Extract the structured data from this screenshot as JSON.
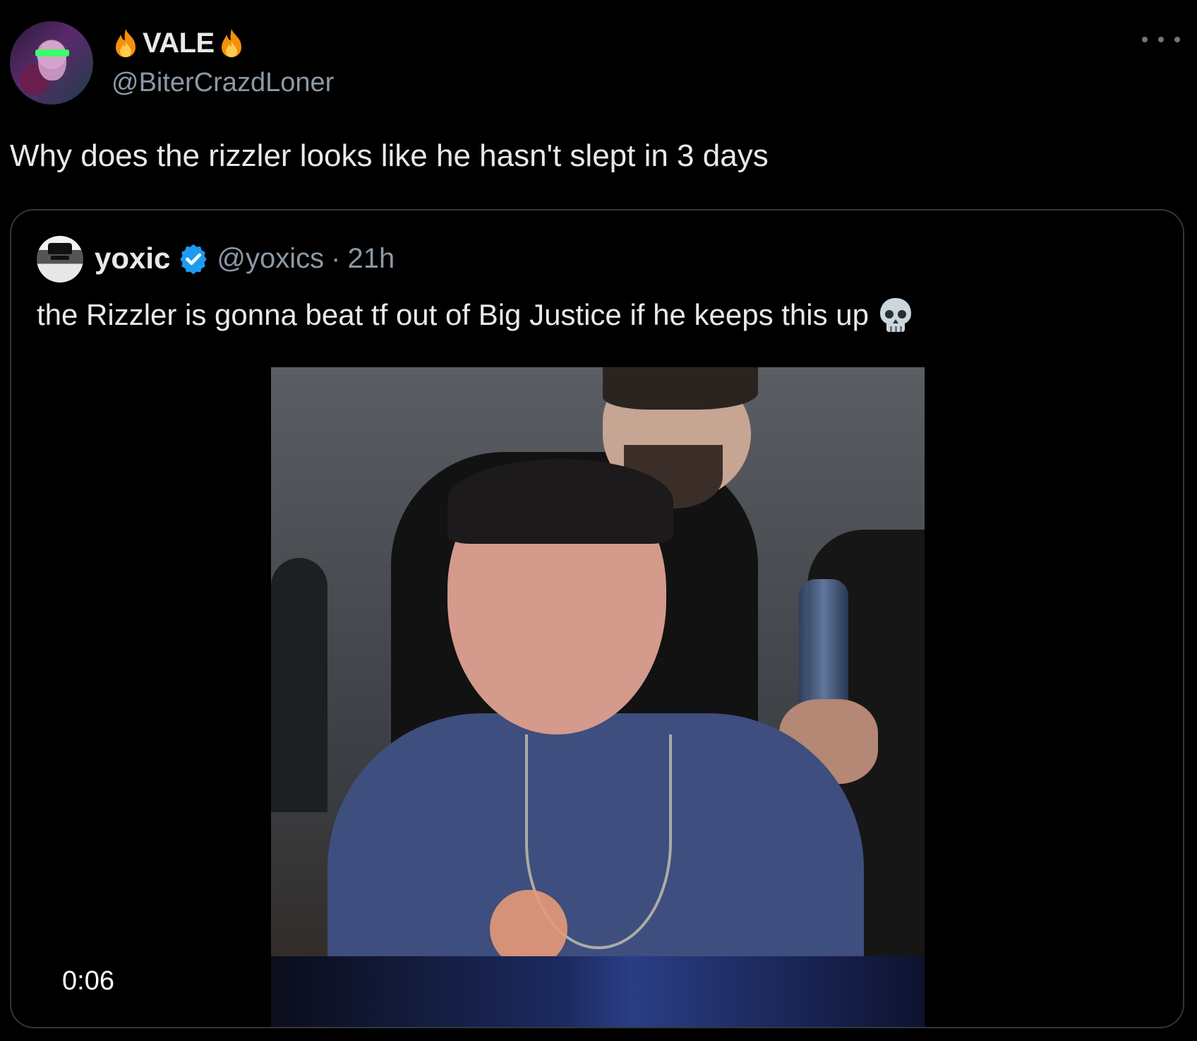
{
  "tweet": {
    "display_name": "VALE",
    "name_emoji": "fire",
    "handle": "@BiterCrazdLoner",
    "text": "Why does the rizzler looks like he hasn't slept in 3 days",
    "more_icon": "ellipsis-icon"
  },
  "quoted_tweet": {
    "display_name": "yoxic",
    "verified": true,
    "handle": "@yoxics",
    "separator": "·",
    "time": "21h",
    "text": "the Rizzler is gonna beat tf out of Big Justice if he keeps this up",
    "emoji": "skull",
    "video": {
      "timestamp": "0:06"
    }
  },
  "colors": {
    "background": "#000000",
    "text_primary": "#e7e9ea",
    "text_secondary": "#8b98a5",
    "border": "#333639",
    "verified_blue": "#1d9bf0"
  }
}
